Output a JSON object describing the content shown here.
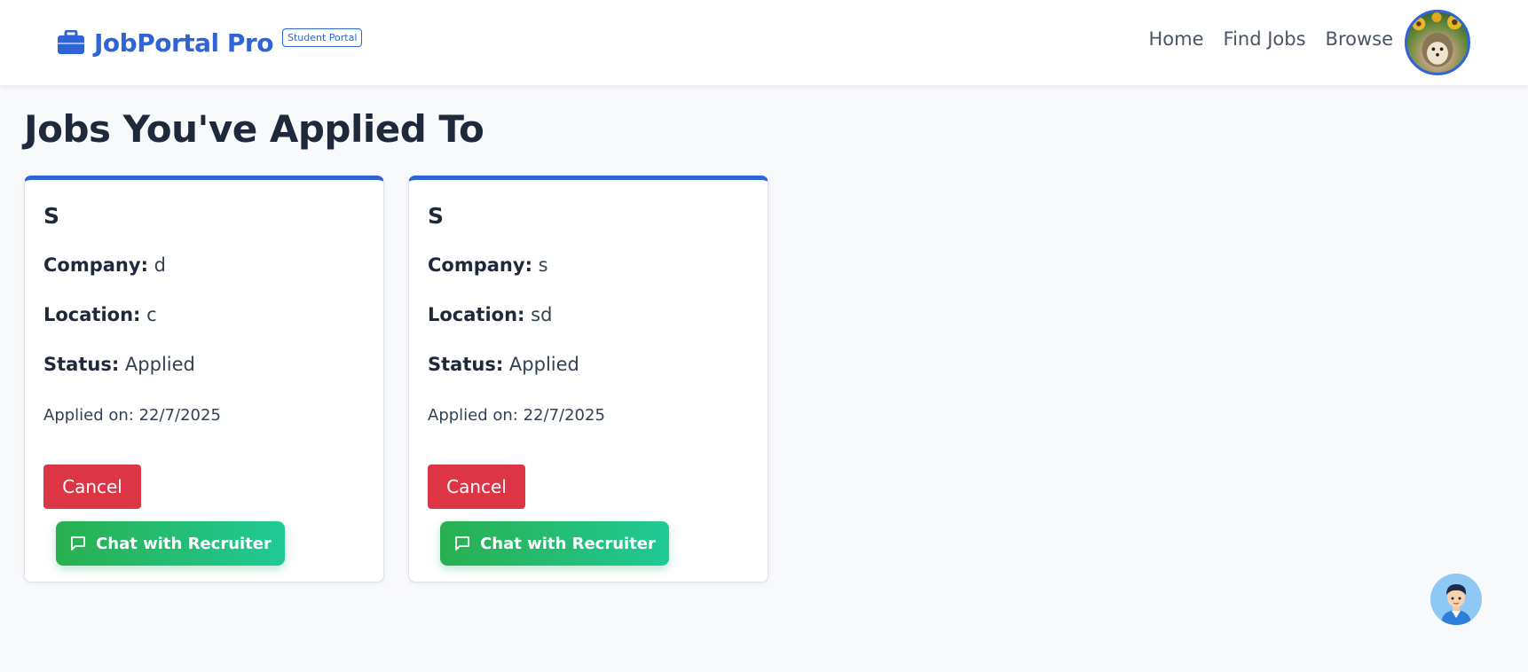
{
  "header": {
    "brand_name": "JobPortal Pro",
    "brand_badge": "Student Portal",
    "brand_icon": "briefcase-icon",
    "nav_links": [
      "Home",
      "Find Jobs",
      "Browse"
    ],
    "accent_color": "#2f64d6"
  },
  "main": {
    "title": "Jobs You've Applied To",
    "applications": [
      {
        "title": "S",
        "company_label": "Company:",
        "company": "d",
        "location_label": "Location:",
        "location": "c",
        "status_label": "Status:",
        "status": "Applied",
        "applied_on": "Applied on: 22/7/2025",
        "cancel_label": "Cancel",
        "chat_label": "Chat with Recruiter"
      },
      {
        "title": "S",
        "company_label": "Company:",
        "company": "s",
        "location_label": "Location:",
        "location": "sd",
        "status_label": "Status:",
        "status": "Applied",
        "applied_on": "Applied on: 22/7/2025",
        "cancel_label": "Cancel",
        "chat_label": "Chat with Recruiter"
      }
    ]
  },
  "colors": {
    "cancel": "#dc3545",
    "chat_start": "#28b04f",
    "chat_end": "#20c997"
  }
}
